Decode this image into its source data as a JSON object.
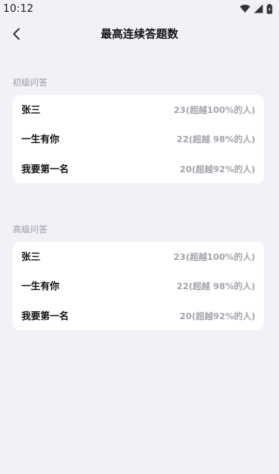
{
  "status_bar": {
    "time": "10:12",
    "icons": [
      "wifi-icon",
      "signal-icon",
      "battery-icon"
    ]
  },
  "nav": {
    "title": "最高连续答题数",
    "back_icon": "chevron-left-icon"
  },
  "sections": [
    {
      "label": "初级问答",
      "rows": [
        {
          "name": "张三",
          "score": "23(超越100%的人)"
        },
        {
          "name": "一生有你",
          "score": "22(超越 98%的人)"
        },
        {
          "name": "我要第一名",
          "score": "20(超越92%的人)"
        }
      ]
    },
    {
      "label": "高级问答",
      "rows": [
        {
          "name": "张三",
          "score": "23(超越100%的人)"
        },
        {
          "name": "一生有你",
          "score": "22(超越 98%的人)"
        },
        {
          "name": "我要第一名",
          "score": "20(超越92%的人)"
        }
      ]
    }
  ],
  "colors": {
    "background": "#f2f1f8",
    "card": "#ffffff",
    "section_label": "#9a9aa2",
    "score_text": "#a4a4ad"
  }
}
